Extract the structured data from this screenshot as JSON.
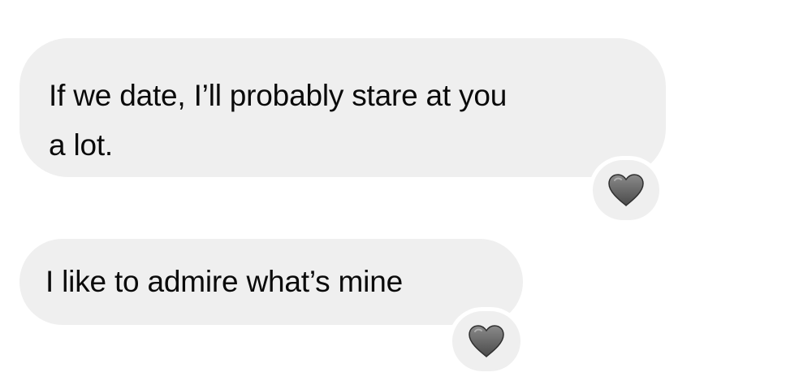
{
  "messages": [
    {
      "text": "If we date, I’ll probably stare at you\na lot.",
      "reaction": "grey-heart-icon"
    },
    {
      "text": "I like to admire what’s mine",
      "reaction": "grey-heart-icon"
    }
  ],
  "colors": {
    "bubble_background": "#efefef",
    "text": "#0a0a0a",
    "heart_fill": "#6f6f6f"
  }
}
